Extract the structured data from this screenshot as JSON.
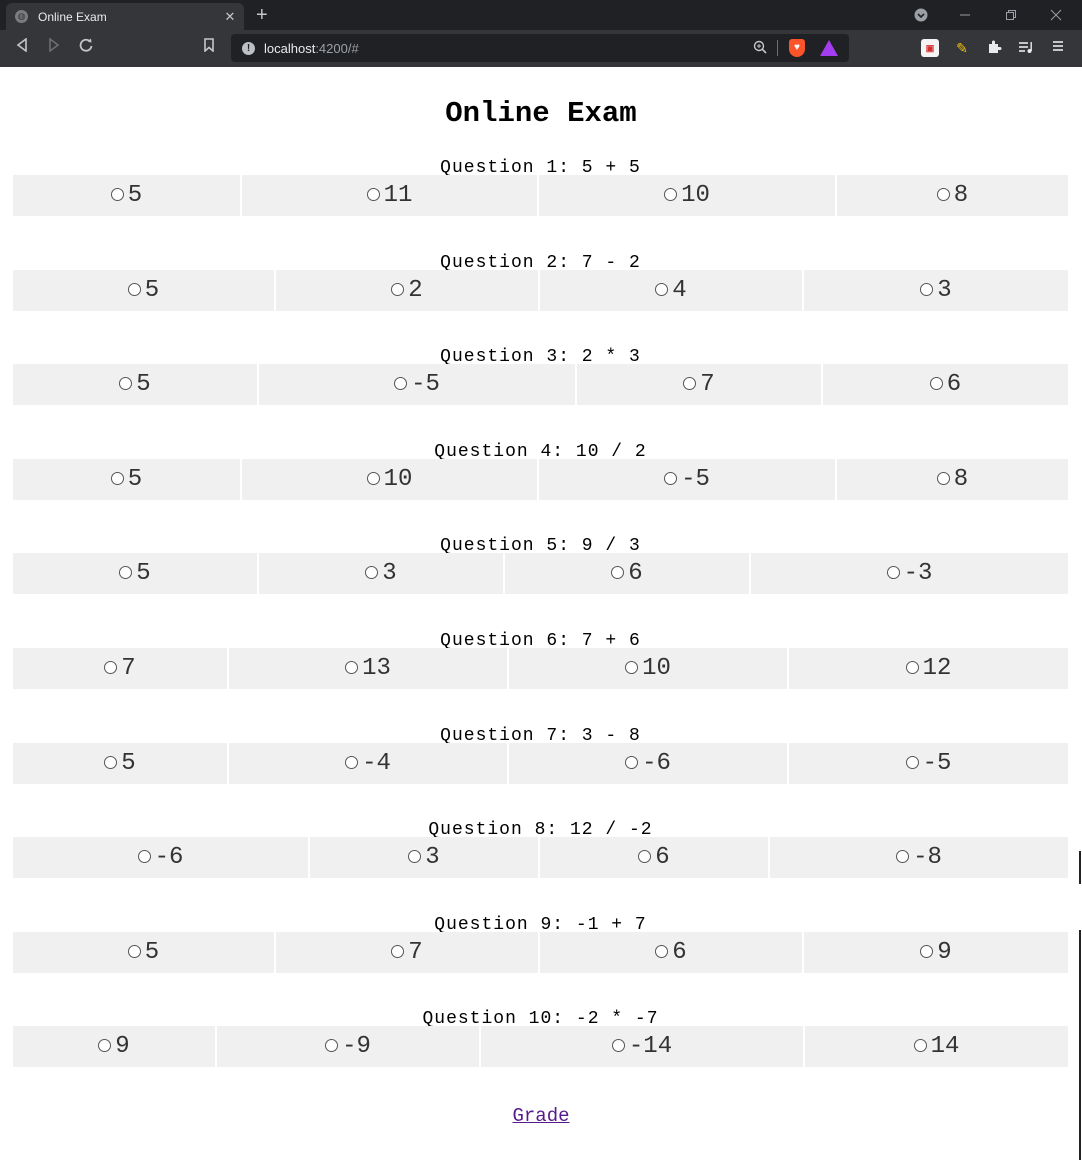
{
  "browser": {
    "tab_title": "Online Exam",
    "tab_close": "✕",
    "new_tab": "+",
    "url_host": "localhost",
    "url_path": ":4200/#"
  },
  "page": {
    "title": "Online Exam",
    "grade_link": "Grade"
  },
  "questions": [
    {
      "label": "Question 1: 5 + 5",
      "answers": [
        "5",
        "11",
        "10",
        "8"
      ]
    },
    {
      "label": "Question 2: 7 - 2",
      "answers": [
        "5",
        "2",
        "4",
        "3"
      ]
    },
    {
      "label": "Question 3: 2 * 3",
      "answers": [
        "5",
        "-5",
        "7",
        "6"
      ]
    },
    {
      "label": "Question 4: 10 / 2",
      "answers": [
        "5",
        "10",
        "-5",
        "8"
      ]
    },
    {
      "label": "Question 5: 9 / 3",
      "answers": [
        "5",
        "3",
        "6",
        "-3"
      ]
    },
    {
      "label": "Question 6: 7 + 6",
      "answers": [
        "7",
        "13",
        "10",
        "12"
      ]
    },
    {
      "label": "Question 7: 3 - 8",
      "answers": [
        "5",
        "-4",
        "-6",
        "-5"
      ]
    },
    {
      "label": "Question 8: 12 / -2",
      "answers": [
        "-6",
        "3",
        "6",
        "-8"
      ]
    },
    {
      "label": "Question 9: -1 + 7",
      "answers": [
        "5",
        "7",
        "6",
        "9"
      ]
    },
    {
      "label": "Question 10: -2 * -7",
      "answers": [
        "9",
        "-9",
        "-14",
        "14"
      ]
    }
  ]
}
